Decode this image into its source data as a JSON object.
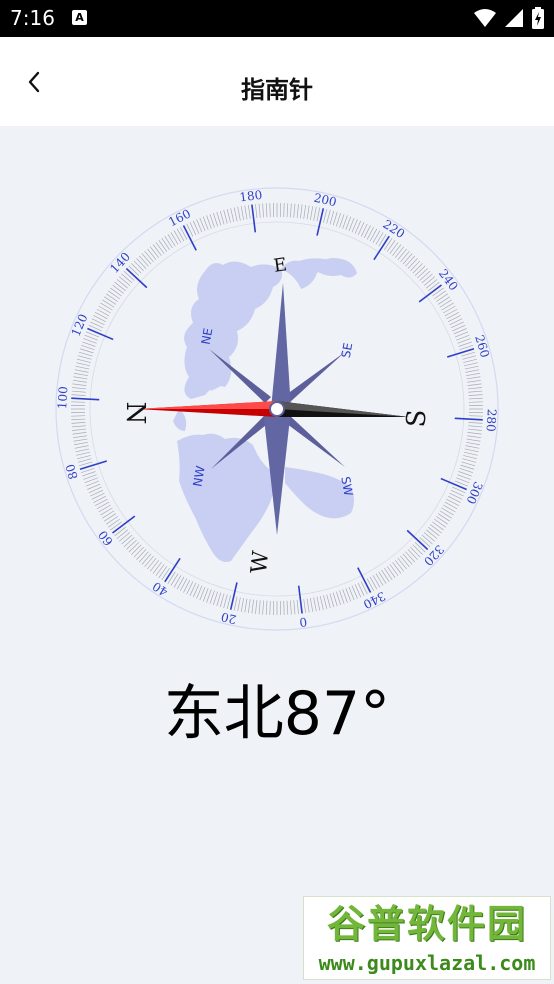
{
  "status_bar": {
    "time": "7:16",
    "notification_icon": "A",
    "icons": [
      "wifi-icon",
      "signal-icon",
      "battery-charging-icon"
    ]
  },
  "header": {
    "title": "指南针",
    "back_icon": "chevron-left-icon"
  },
  "compass": {
    "heading_text": "东北87°",
    "heading_degrees": 87,
    "ring_labels": [
      "0",
      "20",
      "40",
      "60",
      "80",
      "100",
      "120",
      "140",
      "160",
      "180",
      "200",
      "220",
      "240",
      "260",
      "280",
      "300",
      "320",
      "340"
    ],
    "cardinals": {
      "north": "N",
      "east": "E",
      "south": "S",
      "west": "W"
    },
    "intercardinals": {
      "northeast": "NE",
      "southeast": "SE",
      "southwest": "SW",
      "northwest": "NW"
    },
    "colors": {
      "ring_text": "#2f3fc8",
      "ring_ticks": "#a9a9b5",
      "world_map": "#c9cff2",
      "needle_north": "#d00000",
      "needle_south": "#1a1a1a",
      "rose_arm": "#5c5f9a"
    }
  },
  "watermark": {
    "logo": "谷普软件园",
    "url": "www.gupuxlazal.com"
  }
}
